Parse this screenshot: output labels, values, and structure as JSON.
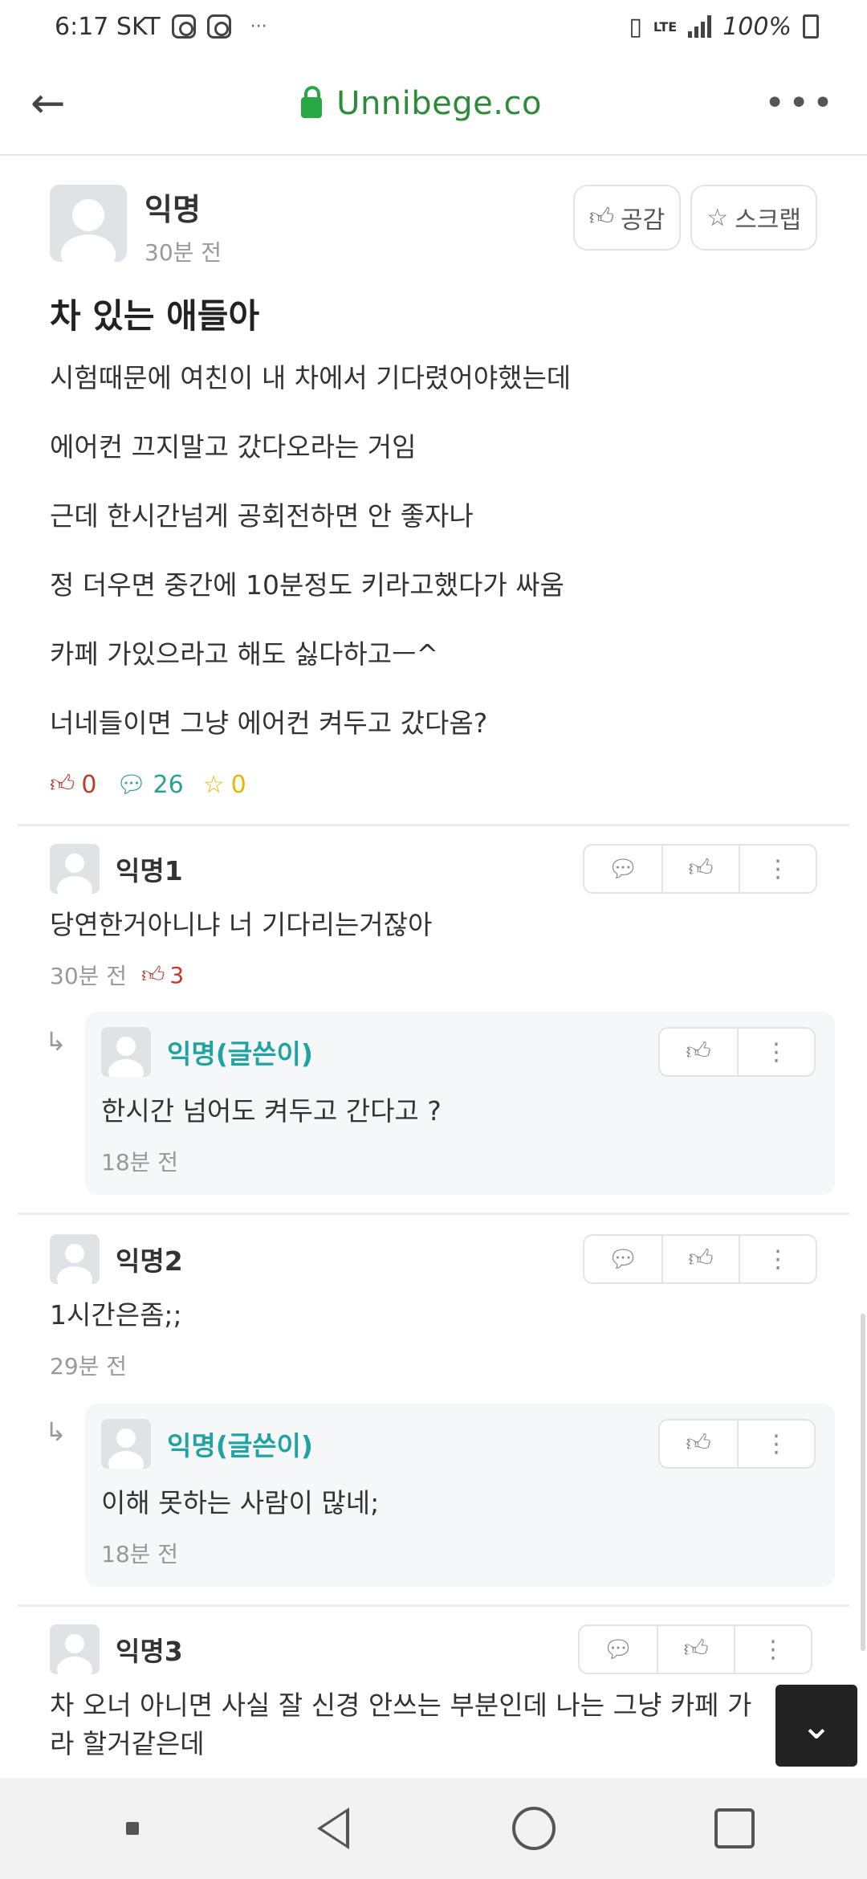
{
  "status_bar": {
    "time_carrier": "6:17 SKT",
    "more": "···",
    "network": "LTE",
    "battery": "100%"
  },
  "browser": {
    "url": "Unnibege.co"
  },
  "post": {
    "author": "익명",
    "time": "30분 전",
    "like_label": "공감",
    "scrap_label": "스크랩",
    "title": "차 있는 애들아",
    "lines": [
      "시험때문에 여친이 내 차에서 기다렸어야했는데",
      "에어컨 끄지말고 갔다오라는 거임",
      "근데 한시간넘게 공회전하면 안 좋자나",
      "정 더우면 중간에 10분정도 키라고했다가 싸움",
      "카페 가있으라고 해도 싫다하고ㅡ^",
      "너네들이면 그냥 에어컨 켜두고 갔다옴?"
    ],
    "stats": {
      "likes": "0",
      "comments": "26",
      "scraps": "0"
    }
  },
  "comments": [
    {
      "author": "익명1",
      "text": "당연한거아니냐 너 기다리는거잖아",
      "time": "30분 전",
      "likes": "3",
      "reply": {
        "author": "익명(글쓴이)",
        "text": "한시간 넘어도 켜두고 간다고 ?",
        "time": "18분 전"
      }
    },
    {
      "author": "익명2",
      "text": "1시간은좀;;",
      "time": "29분 전",
      "reply": {
        "author": "익명(글쓴이)",
        "text": "이해 못하는 사람이 많네;",
        "time": "18분 전"
      }
    },
    {
      "author": "익명3",
      "text": "차 오너 아니면 사실 잘 신경 안쓰는 부분인데 나는 그냥 카페 가라 할거같은데"
    }
  ],
  "icons": {
    "like": "thumbs-up-icon",
    "comment": "speech-bubble-icon",
    "scrap": "star-icon",
    "more": "vertical-dots-icon"
  },
  "colors": {
    "accent_green": "#2e8b3a",
    "op_teal": "#21a3a3",
    "like_red": "#c0392b",
    "comment_teal": "#2aa198",
    "scrap_yellow": "#e6b800"
  }
}
